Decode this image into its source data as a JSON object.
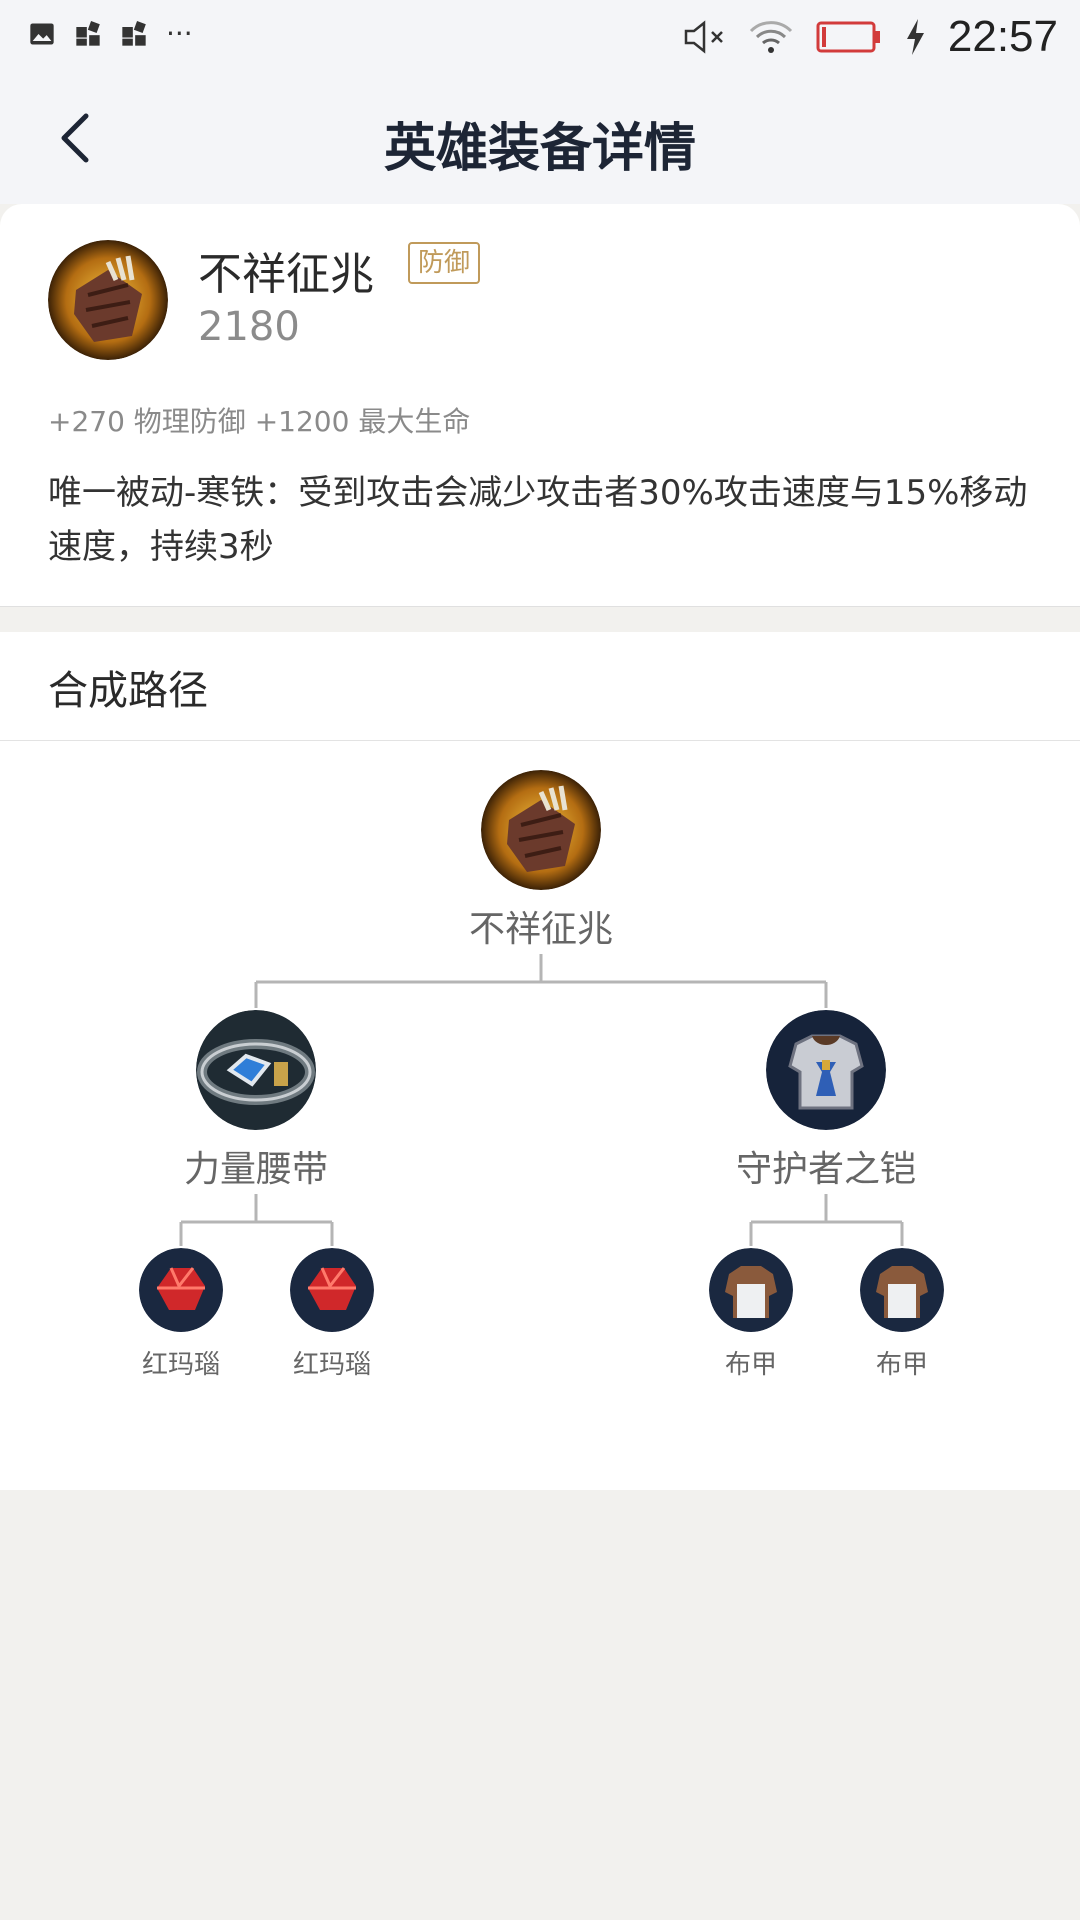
{
  "status_bar": {
    "time": "22:57",
    "icons": [
      "image-icon",
      "app-grid-icon",
      "app-grid-icon",
      "more-dots-icon",
      "mute-icon",
      "wifi-icon",
      "battery-low-icon",
      "charging-icon"
    ]
  },
  "nav": {
    "title": "英雄装备详情",
    "back_icon": "back-arrow-icon"
  },
  "item": {
    "name": "不祥征兆",
    "tag": "防御",
    "price": "2180",
    "stats": "+270 物理防御 +1200 最大生命",
    "description": "唯一被动-寒铁：受到攻击会减少攻击者30%攻击速度与15%移动速度，持续3秒",
    "accent_color": "#c09a5a"
  },
  "path": {
    "title": "合成路径",
    "root": {
      "name": "不祥征兆",
      "icon": "omen-icon"
    },
    "children": [
      {
        "name": "力量腰带",
        "icon": "belt-icon",
        "children": [
          {
            "name": "红玛瑙",
            "icon": "red-gem-icon"
          },
          {
            "name": "红玛瑙",
            "icon": "red-gem-icon"
          }
        ]
      },
      {
        "name": "守护者之铠",
        "icon": "armor-icon",
        "children": [
          {
            "name": "布甲",
            "icon": "cloth-armor-icon"
          },
          {
            "name": "布甲",
            "icon": "cloth-armor-icon"
          }
        ]
      }
    ]
  }
}
